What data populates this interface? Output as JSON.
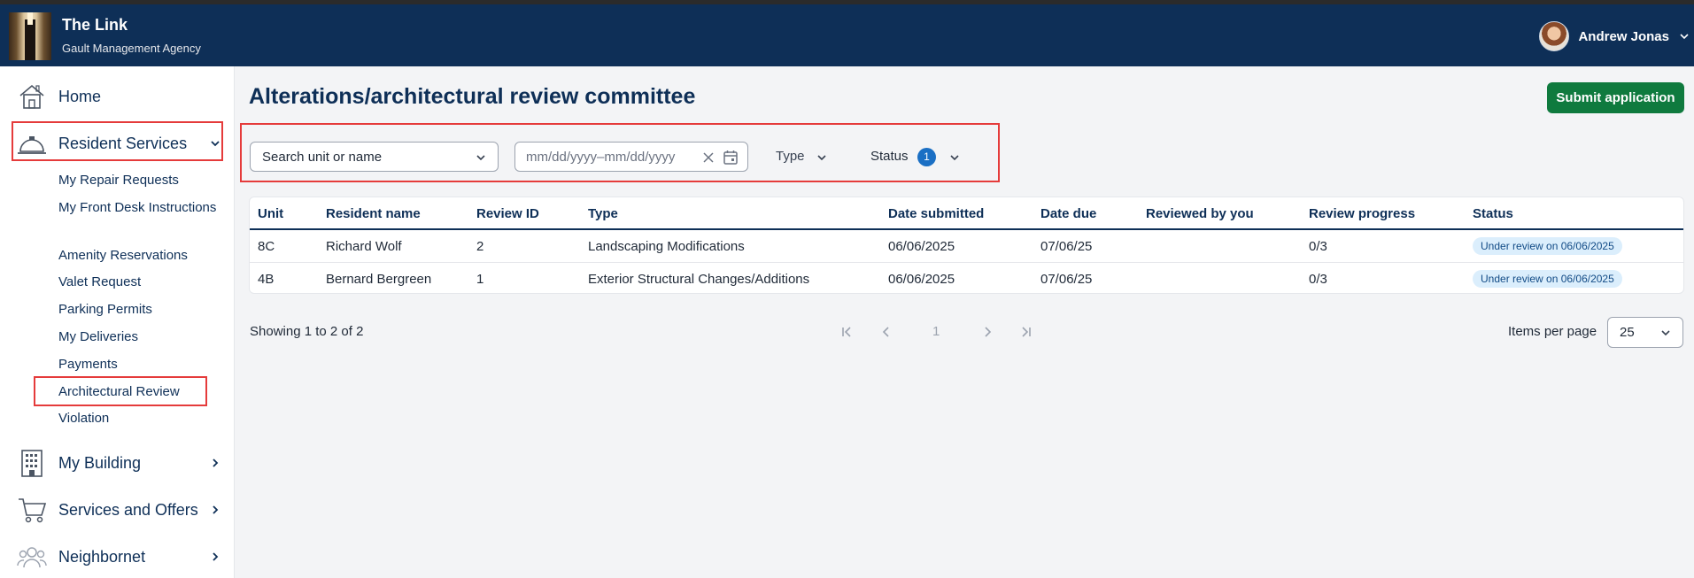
{
  "header": {
    "title": "The Link",
    "subtitle": "Gault Management Agency",
    "user_name": "Andrew Jonas"
  },
  "sidebar": {
    "home": "Home",
    "resident_services": "Resident Services",
    "sub_items": [
      "My Repair Requests",
      "My Front Desk Instructions",
      "Amenity Reservations",
      "Valet Request",
      "Parking Permits",
      "My Deliveries",
      "Payments",
      "Architectural Review",
      "Violation"
    ],
    "my_building": "My Building",
    "services_offers": "Services and Offers",
    "neighbornet": "Neighbornet"
  },
  "main": {
    "title": "Alterations/architectural review committee",
    "submit_label": "Submit application",
    "filters": {
      "search_placeholder": "Search unit or name",
      "date_placeholder": "mm/dd/yyyy–mm/dd/yyyy",
      "type_label": "Type",
      "status_label": "Status",
      "status_count": "1"
    },
    "table": {
      "columns": [
        "Unit",
        "Resident name",
        "Review ID",
        "Type",
        "Date submitted",
        "Date due",
        "Reviewed by you",
        "Review progress",
        "Status"
      ],
      "rows": [
        {
          "unit": "8C",
          "resident": "Richard Wolf",
          "review_id": "2",
          "type": "Landscaping Modifications",
          "submitted": "06/06/2025",
          "due": "07/06/25",
          "reviewed_by_you": "",
          "progress": "0/3",
          "status": "Under review on 06/06/2025"
        },
        {
          "unit": "4B",
          "resident": "Bernard Bergreen",
          "review_id": "1",
          "type": "Exterior Structural Changes/Additions",
          "submitted": "06/06/2025",
          "due": "07/06/25",
          "reviewed_by_you": "",
          "progress": "0/3",
          "status": "Under review on 06/06/2025"
        }
      ]
    },
    "pagination": {
      "showing": "Showing 1 to 2 of 2",
      "current_page": "1",
      "items_per_page_label": "Items per page",
      "items_per_page": "25"
    }
  },
  "colors": {
    "header_bg": "#0e2f57",
    "submit_bg": "#0f7a3e",
    "highlight": "#e53b3b",
    "badge_bg": "#dbeefc",
    "status_count_bg": "#1a6fc4"
  },
  "icons": [
    "home-icon",
    "bell-icon",
    "building-icon",
    "cart-icon",
    "people-icon",
    "chevron-down-icon",
    "chevron-right-icon",
    "clear-icon",
    "calendar-icon",
    "first-page-icon",
    "prev-page-icon",
    "next-page-icon",
    "last-page-icon"
  ]
}
